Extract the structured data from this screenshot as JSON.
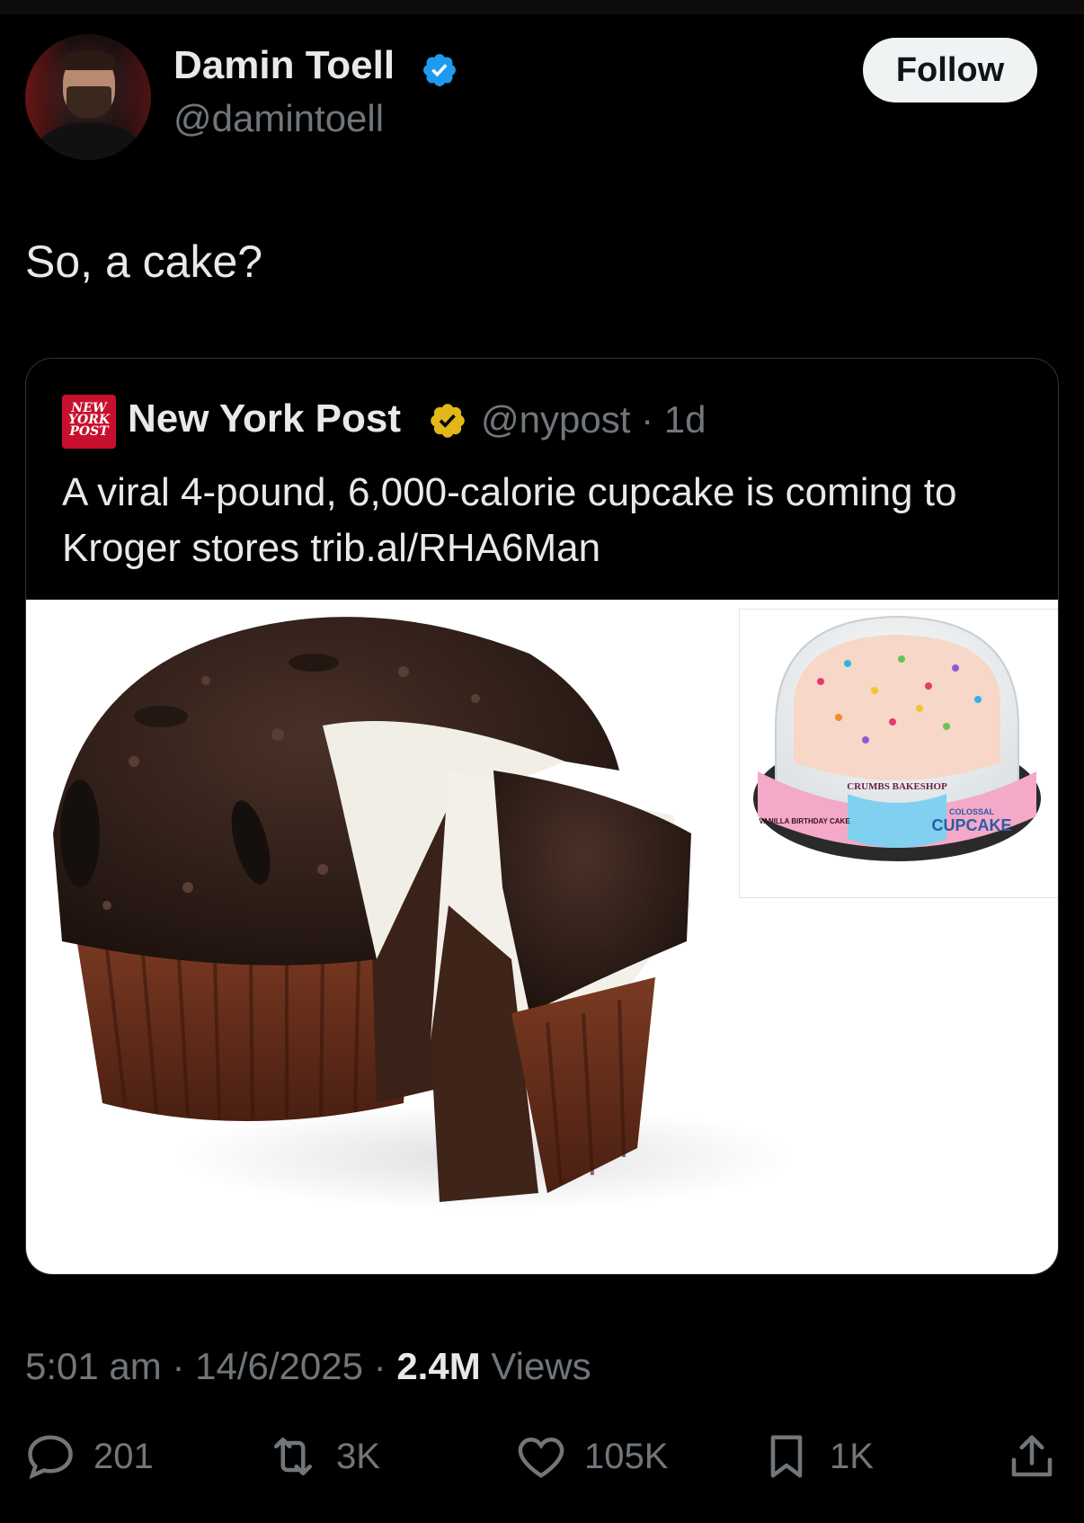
{
  "author": {
    "name": "Damin Toell",
    "handle": "@damintoell"
  },
  "follow_label": "Follow",
  "tweet_text": "So, a cake?",
  "quoted": {
    "logo_text": "NEW YORK POST",
    "name": "New York Post",
    "handle": "@nypost",
    "separator": "·",
    "age": "1d",
    "text": "A viral 4-pound, 6,000-calorie cupcake is coming to Kroger stores trib.al/RHA6Man",
    "package_labels": {
      "brand": "CRUMBS BAKESHOP",
      "flavor": "VANILLA BIRTHDAY CAKE",
      "product_top": "COLOSSAL",
      "product": "CUPCAKE"
    }
  },
  "meta": {
    "time": "5:01 am",
    "sep1": "·",
    "date": "14/6/2025",
    "sep2": "·",
    "views_count": "2.4M",
    "views_label": "Views"
  },
  "actions": {
    "replies": "201",
    "reposts": "3K",
    "likes": "105K",
    "bookmarks": "1K"
  },
  "colors": {
    "background": "#000000",
    "text_primary": "#e7e9ea",
    "text_secondary": "#71767b",
    "verified_blue": "#1d9bf0",
    "verified_gold": "#e2b719",
    "nypost_red": "#c8102e"
  }
}
